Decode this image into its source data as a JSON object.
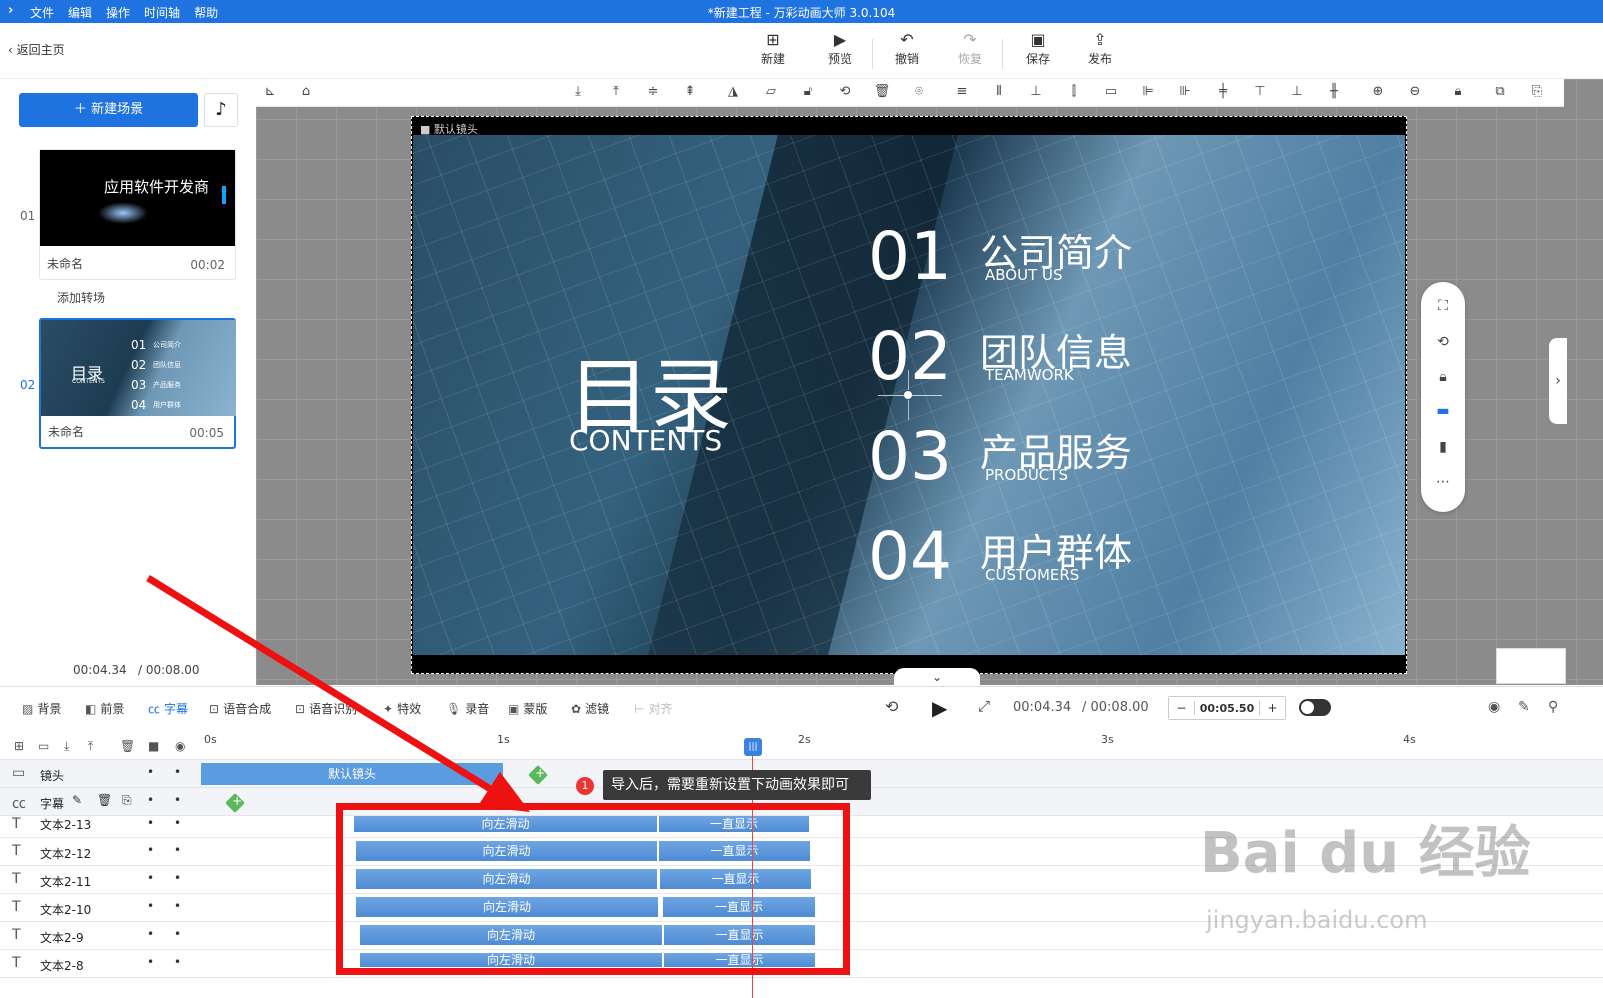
{
  "menubar": {
    "logo": "›",
    "items": [
      "文件",
      "编辑",
      "操作",
      "时间轴",
      "帮助"
    ],
    "title": "*新建工程 - 万彩动画大师 3.0.104"
  },
  "toolbar": {
    "back": "返回主页",
    "new": "新建",
    "preview": "预览",
    "undo": "撤销",
    "redo": "恢复",
    "save": "保存",
    "publish": "发布"
  },
  "left": {
    "new_scene": "新建场景",
    "scenes": [
      {
        "index": "01",
        "name": "未命名",
        "duration": "00:02",
        "thumb_text": "应用软件开发商"
      },
      {
        "index": "02",
        "name": "未命名",
        "duration": "00:05",
        "thumb_title": "目录",
        "thumb_sub": "CONTENTS",
        "thumb_items": [
          "01",
          "02",
          "03",
          "04"
        ],
        "thumb_labels": [
          "公司简介",
          "团队信息",
          "产品服务",
          "用户群体"
        ]
      }
    ],
    "add_transition": "添加转场",
    "time": "00:04.34",
    "total": "/ 00:08.00"
  },
  "stage": {
    "label": "默认镜头",
    "title": "目录",
    "subtitle": "CONTENTS",
    "items": [
      {
        "num": "01",
        "cn": "公司简介",
        "en": "ABOUT US"
      },
      {
        "num": "02",
        "cn": "团队信息",
        "en": "TEAMWORK"
      },
      {
        "num": "03",
        "cn": "产品服务",
        "en": "PRODUCTS"
      },
      {
        "num": "04",
        "cn": "用户群体",
        "en": "CUSTOMERS"
      }
    ]
  },
  "timeline_bar": {
    "items": [
      "背景",
      "前景",
      "字幕",
      "语音合成",
      "语音识别",
      "特效",
      "录音",
      "蒙版",
      "滤镜",
      "对齐"
    ],
    "current": "00:04.34",
    "total": "/ 00:08.00",
    "zoom": "00:05.50",
    "minus": "−",
    "plus": "+"
  },
  "ruler": [
    "0s",
    "1s",
    "2s",
    "3s",
    "4s"
  ],
  "tracks": {
    "lens": "镜头",
    "lens_bar": "默认镜头",
    "subtitle": "字幕",
    "rows": [
      "文本2-13",
      "文本2-12",
      "文本2-11",
      "文本2-10",
      "文本2-9",
      "文本2-8"
    ],
    "anim_in": "向左滑动",
    "anim_hold": "一直显示"
  },
  "tooltip": {
    "num": "1",
    "text": "导入后，需要重新设置下动画效果即可"
  },
  "watermark": {
    "main": "Bai du 经验",
    "sub": "jingyan.baidu.com"
  }
}
